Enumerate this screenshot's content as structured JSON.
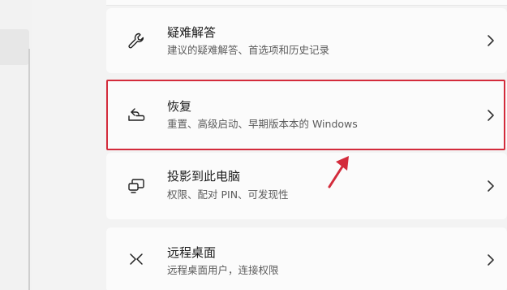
{
  "settings": {
    "items": [
      {
        "title": "疑难解答",
        "subtitle": "建议的疑难解答、首选项和历史记录",
        "icon": "wrench-icon"
      },
      {
        "title": "恢复",
        "subtitle": "重置、高级启动、早期版本本的 Windows",
        "icon": "recovery-icon"
      },
      {
        "title": "投影到此电脑",
        "subtitle": "权限、配对 PIN、可发现性",
        "icon": "project-to-pc-icon"
      },
      {
        "title": "远程桌面",
        "subtitle": "远程桌面用户，连接权限",
        "icon": "remote-desktop-icon"
      }
    ]
  },
  "annotation": {
    "highlight_color": "#d32b3b",
    "highlighted_item": "恢复"
  }
}
